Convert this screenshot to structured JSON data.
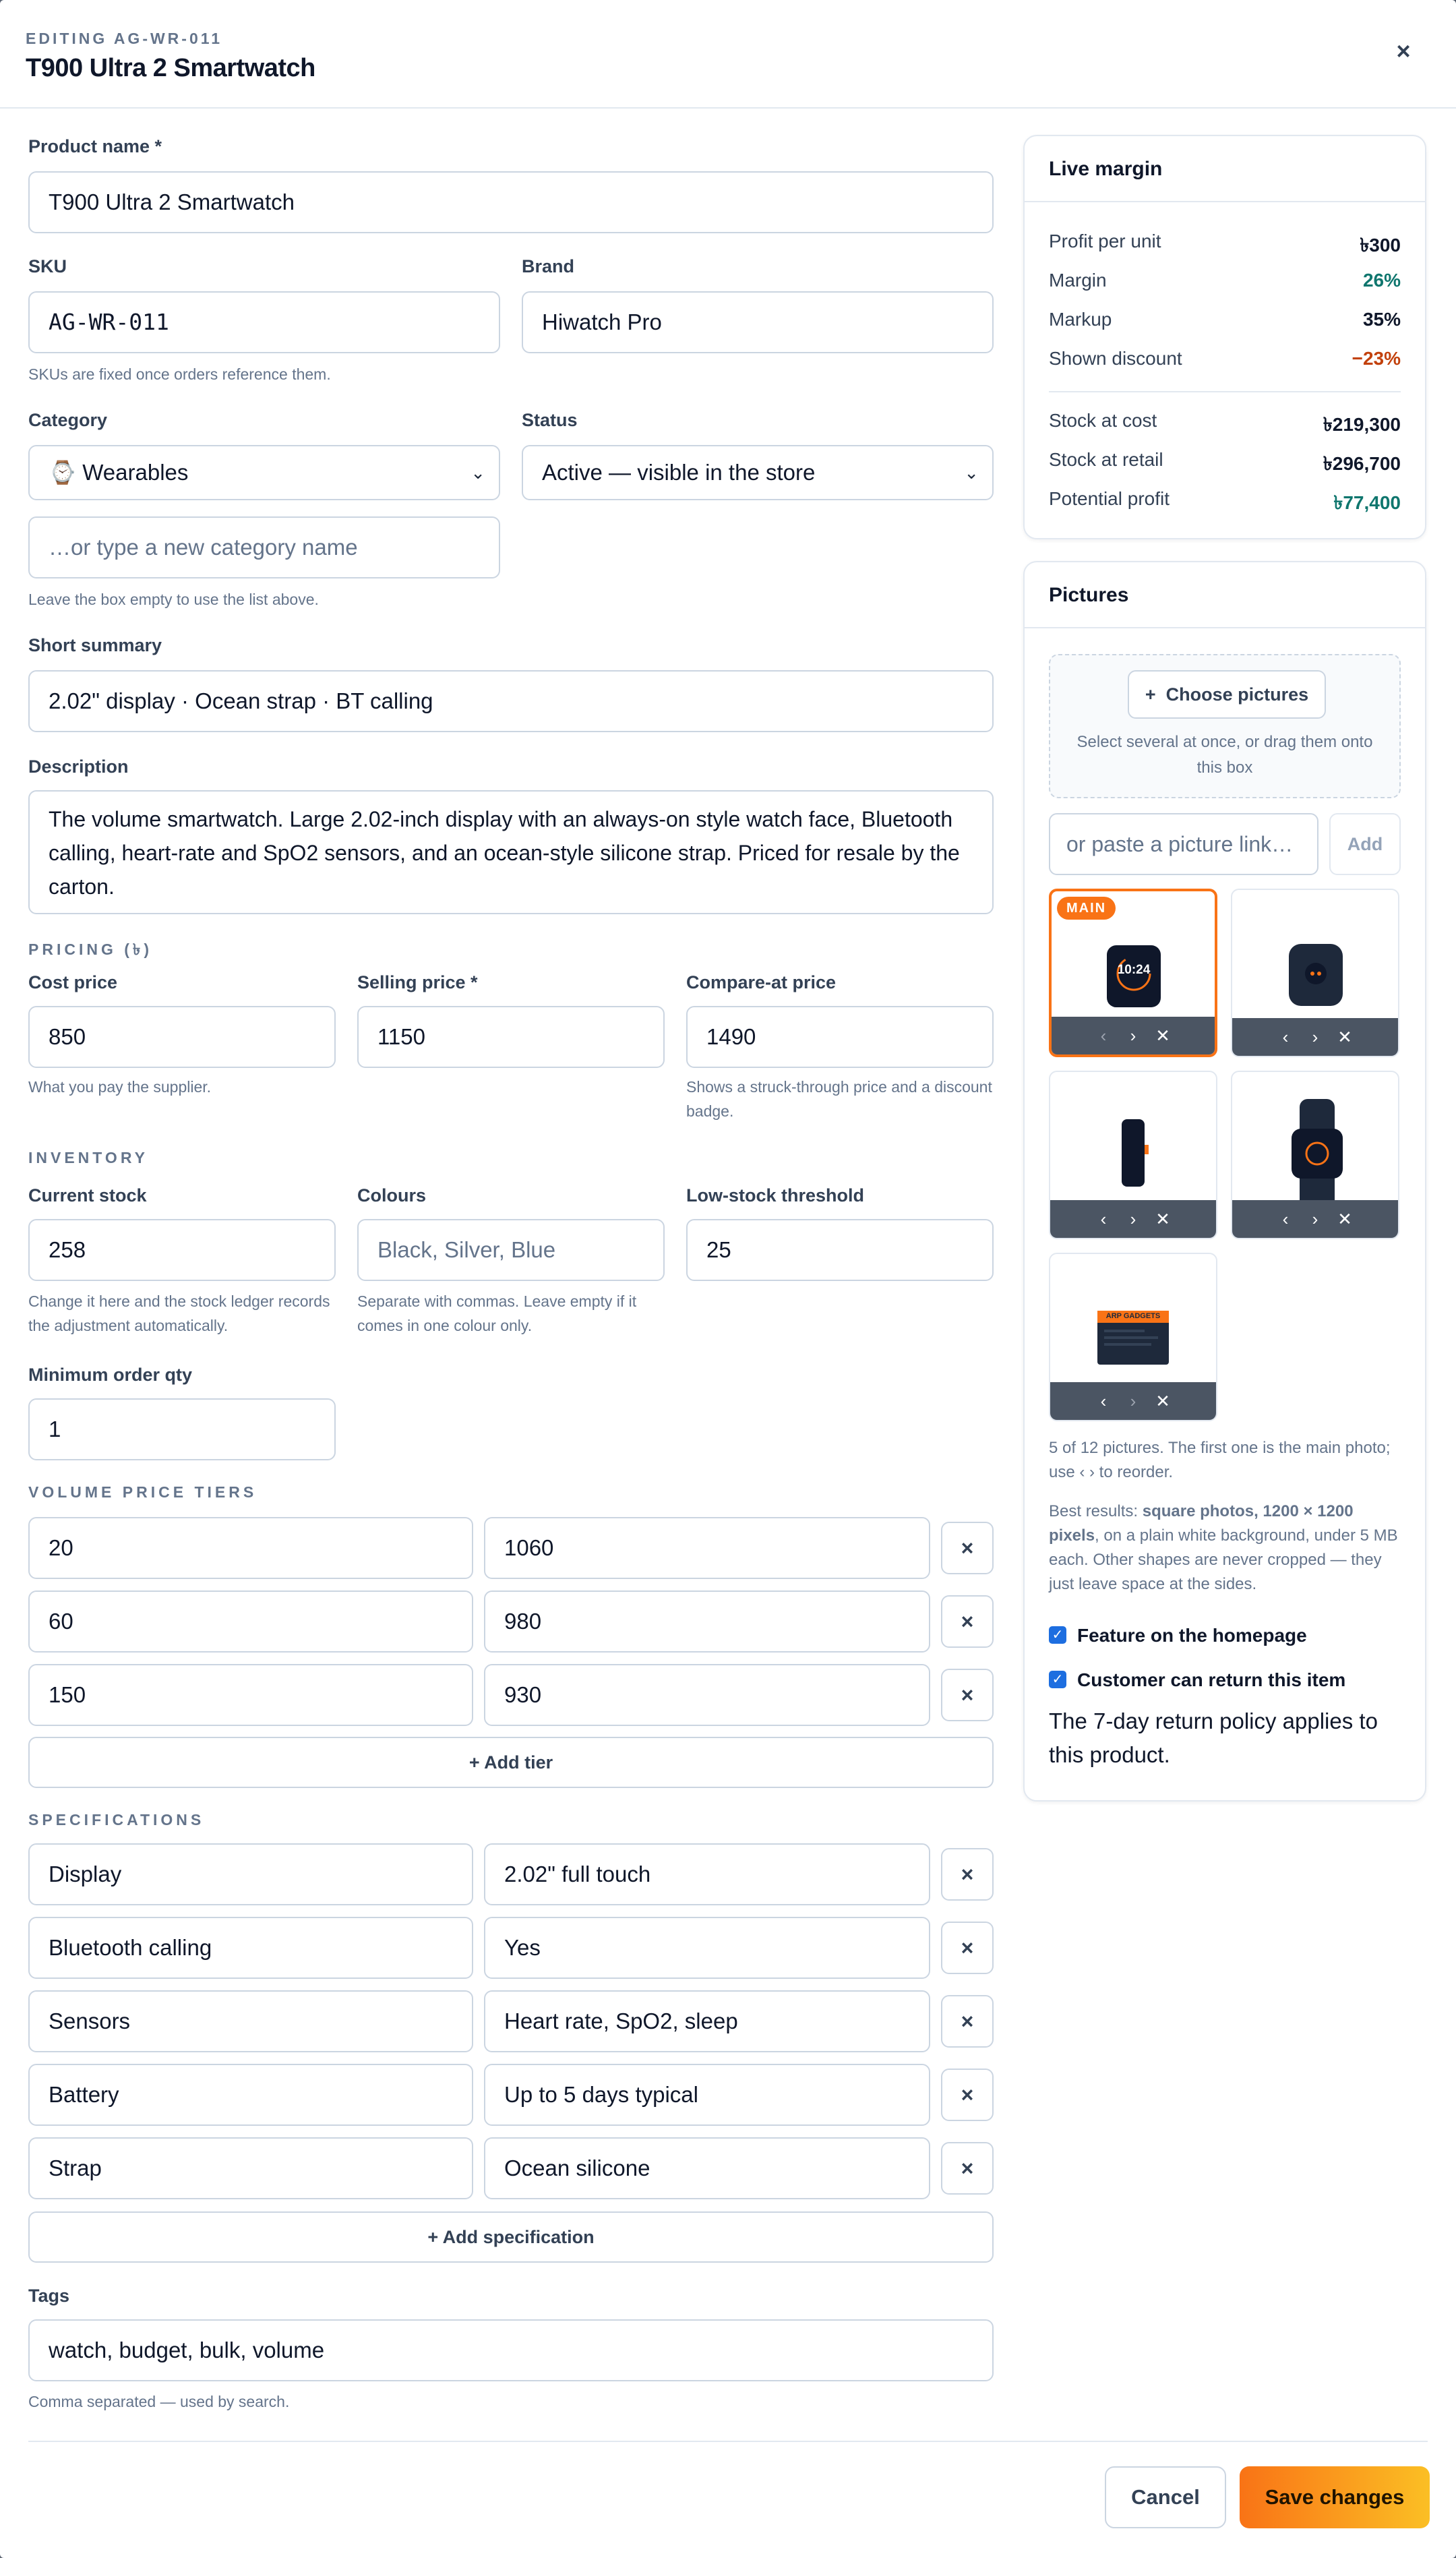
{
  "header": {
    "eyebrow": "EDITING AG-WR-011",
    "title": "T900 Ultra 2 Smartwatch",
    "close_glyph": "×"
  },
  "form": {
    "product_name": {
      "label": "Product name *",
      "value": "T900 Ultra 2 Smartwatch"
    },
    "sku": {
      "label": "SKU",
      "value": "AG-WR-011",
      "help": "SKUs are fixed once orders reference them."
    },
    "brand": {
      "label": "Brand",
      "value": "Hiwatch Pro"
    },
    "category": {
      "label": "Category",
      "value": "⌚ Wearables",
      "new_placeholder": "…or type a new category name",
      "help": "Leave the box empty to use the list above."
    },
    "status": {
      "label": "Status",
      "value": "Active — visible in the store"
    },
    "short_summary": {
      "label": "Short summary",
      "value": "2.02\" display · Ocean strap · BT calling"
    },
    "description": {
      "label": "Description",
      "value": "The volume smartwatch. Large 2.02-inch display with an always-on style watch face, Bluetooth calling, heart-rate and SpO2 sensors, and an ocean-style silicone strap. Priced for resale by the carton."
    },
    "pricing": {
      "section": "PRICING (৳)",
      "cost": {
        "label": "Cost price",
        "value": "850",
        "help": "What you pay the supplier."
      },
      "selling": {
        "label": "Selling price *",
        "value": "1150"
      },
      "compare": {
        "label": "Compare-at price",
        "value": "1490",
        "help": "Shows a struck-through price and a discount badge."
      }
    },
    "inventory": {
      "section": "INVENTORY",
      "stock": {
        "label": "Current stock",
        "value": "258",
        "help": "Change it here and the stock ledger records the adjustment automatically."
      },
      "colours": {
        "label": "Colours",
        "placeholder": "Black, Silver, Blue",
        "help": "Separate with commas. Leave empty if it comes in one colour only."
      },
      "threshold": {
        "label": "Low-stock threshold",
        "value": "25"
      },
      "min_order": {
        "label": "Minimum order qty",
        "value": "1"
      }
    },
    "tiers": {
      "section": "VOLUME PRICE TIERS",
      "rows": [
        {
          "qty": "20",
          "price": "1060"
        },
        {
          "qty": "60",
          "price": "980"
        },
        {
          "qty": "150",
          "price": "930"
        }
      ],
      "add_label": "+ Add tier"
    },
    "specs": {
      "section": "SPECIFICATIONS",
      "rows": [
        {
          "key": "Display",
          "value": "2.02\" full touch"
        },
        {
          "key": "Bluetooth calling",
          "value": "Yes"
        },
        {
          "key": "Sensors",
          "value": "Heart rate, SpO2, sleep"
        },
        {
          "key": "Battery",
          "value": "Up to 5 days typical"
        },
        {
          "key": "Strap",
          "value": "Ocean silicone"
        }
      ],
      "add_label": "+ Add specification"
    },
    "tags": {
      "label": "Tags",
      "value": "watch, budget, bulk, volume",
      "help": "Comma separated — used by search."
    },
    "remove_glyph": "×"
  },
  "margin": {
    "title": "Live margin",
    "rows": [
      {
        "label": "Profit per unit",
        "value": "৳300"
      },
      {
        "label": "Margin",
        "value": "26%"
      },
      {
        "label": "Markup",
        "value": "35%"
      },
      {
        "label": "Shown discount",
        "value": "−23%"
      }
    ],
    "stock_rows": [
      {
        "label": "Stock at cost",
        "value": "৳219,300"
      },
      {
        "label": "Stock at retail",
        "value": "৳296,700"
      },
      {
        "label": "Potential profit",
        "value": "৳77,400"
      }
    ],
    "colors": {
      "positive": "#0f766e",
      "negative": "#c2410c"
    }
  },
  "pictures": {
    "title": "Pictures",
    "choose_label": "Choose pictures",
    "dropzone_help": "Select several at once, or drag them onto this box",
    "link_placeholder": "or paste a picture link…",
    "add_label": "Add",
    "main_badge": "MAIN",
    "watch_time": "10:24",
    "box_label": "ARP GADGETS",
    "count_text": "5 of 12 pictures. The first one is the main photo; use ‹ › to reorder.",
    "best_prefix": "Best results: ",
    "best_strong": "square photos, 1200 × 1200 pixels",
    "best_suffix": ", on a plain white background, under 5 MB each. Other shapes are never cropped — they just leave space at the sides.",
    "feature_label": "Feature on the homepage",
    "return_label": "Customer can return this item",
    "return_policy": "The 7-day return policy applies to this product.",
    "controls": {
      "prev": "‹",
      "next": "›",
      "remove": "✕"
    }
  },
  "footer": {
    "cancel": "Cancel",
    "save": "Save changes"
  },
  "colors": {
    "accent": "#f97316",
    "accent_end": "#fbbf24",
    "checkbox": "#1d6ee0"
  }
}
